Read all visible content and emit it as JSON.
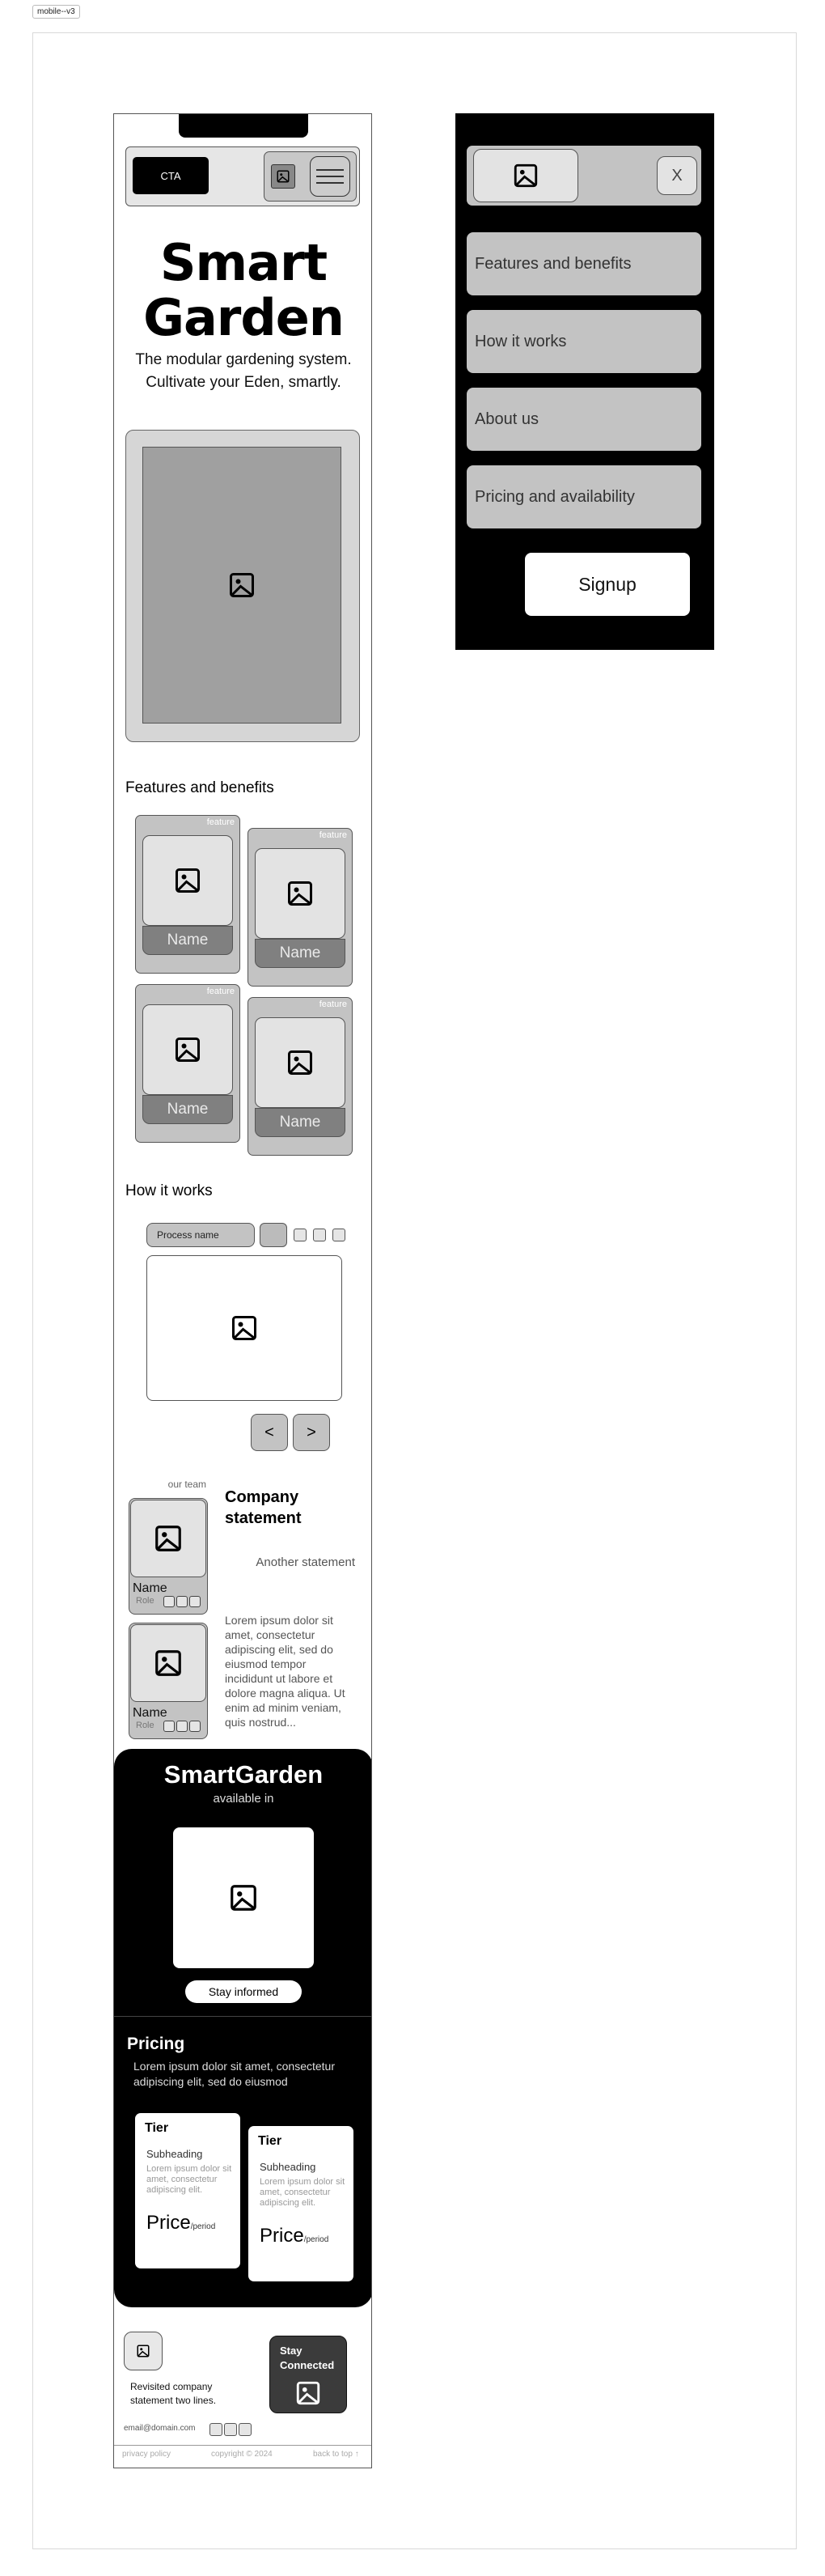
{
  "frame_label": "mobile--v3",
  "header": {
    "cta_label": "CTA",
    "image_icon": "image-icon",
    "menu_icon": "hamburger-menu-icon"
  },
  "hero": {
    "title_line1": "Smart",
    "title_line2": "Garden",
    "subtitle_line1": "The modular gardening system.",
    "subtitle_line2": "Cultivate your Eden, smartly."
  },
  "features": {
    "heading": "Features and benefits",
    "items": [
      {
        "tag": "feature",
        "name": "Name"
      },
      {
        "tag": "feature",
        "name": "Name"
      },
      {
        "tag": "feature",
        "name": "Name"
      },
      {
        "tag": "feature",
        "name": "Name"
      }
    ]
  },
  "how_it_works": {
    "heading": "How it works",
    "process_name": "Process name",
    "prev_label": "<",
    "next_label": ">"
  },
  "about": {
    "our_team": "our team",
    "members": [
      {
        "name": "Name",
        "role": "Role"
      },
      {
        "name": "Name",
        "role": "Role"
      }
    ],
    "company_title": "Company statement",
    "another": "Another statement",
    "lorem": "Lorem ipsum dolor sit amet, consectetur adipiscing elit, sed do eiusmod  tempor incididunt ut labore et dolore magna aliqua. Ut enim ad minim  veniam, quis nostrud..."
  },
  "store": {
    "title": "SmartGarden",
    "available": "available in",
    "stay_label": "Stay informed"
  },
  "pricing": {
    "heading": "Pricing",
    "subtitle": "Lorem ipsum dolor sit amet, consectetur adipiscing elit, sed do eiusmod",
    "tiers": [
      {
        "tier": "Tier",
        "subheading": "Subheading",
        "lorem": "Lorem ipsum dolor sit amet, consectetur adipiscing elit.",
        "price": "Price",
        "period": "/period"
      },
      {
        "tier": "Tier",
        "subheading": "Subheading",
        "lorem": "Lorem ipsum dolor sit amet, consectetur adipiscing elit.",
        "price": "Price",
        "period": "/period"
      }
    ]
  },
  "footer": {
    "statement": "Revisited company statement two lines.",
    "stay_connected": "Stay Connected",
    "email": "email@domain.com",
    "privacy": "privacy policy",
    "copyright": "copyright © 2024",
    "back_to_top": "back to top ↑"
  },
  "menu": {
    "close_label": "X",
    "items": [
      "Features and benefits",
      "How it works",
      "About us",
      "Pricing and availability"
    ],
    "signup_label": "Signup"
  }
}
